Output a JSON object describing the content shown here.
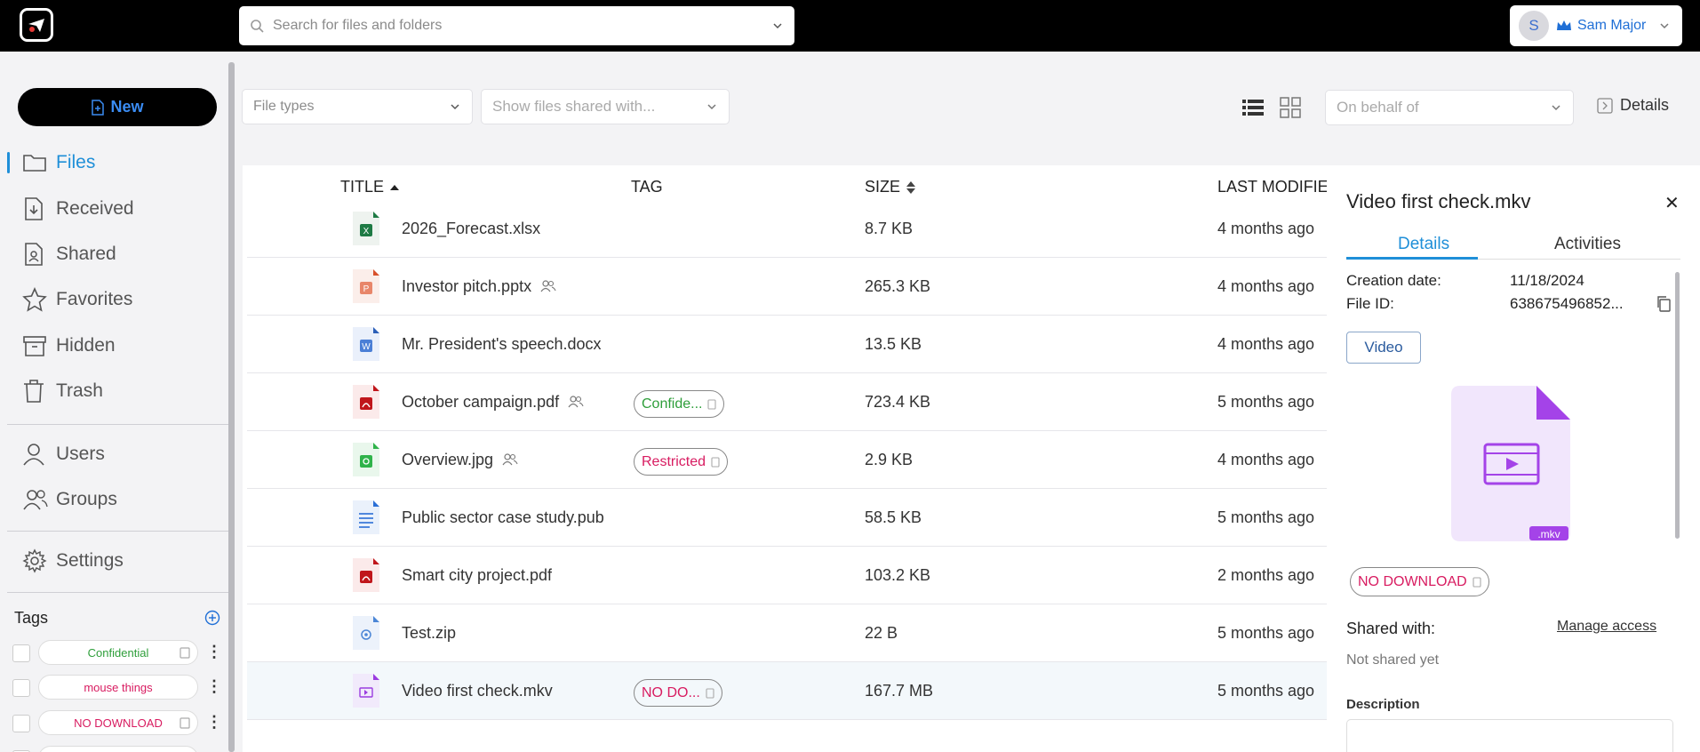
{
  "header": {
    "search_placeholder": "Search for files and folders",
    "user_initial": "S",
    "user_name": "Sam Major"
  },
  "sidebar": {
    "new_label": "New",
    "nav": [
      {
        "label": "Files",
        "icon": "folder-icon"
      },
      {
        "label": "Received",
        "icon": "received-icon"
      },
      {
        "label": "Shared",
        "icon": "shared-icon"
      },
      {
        "label": "Favorites",
        "icon": "star-icon"
      },
      {
        "label": "Hidden",
        "icon": "archive-icon"
      },
      {
        "label": "Trash",
        "icon": "trash-icon"
      },
      {
        "label": "Users",
        "icon": "user-icon"
      },
      {
        "label": "Groups",
        "icon": "groups-icon"
      },
      {
        "label": "Settings",
        "icon": "gear-icon"
      }
    ],
    "tags_title": "Tags",
    "tags": [
      {
        "label": "Confidential",
        "color": "#2e9e3a"
      },
      {
        "label": "mouse things",
        "color": "#d81b60"
      },
      {
        "label": "NO DOWNLOAD",
        "color": "#d81b60"
      }
    ]
  },
  "filters": {
    "file_types_placeholder": "File types",
    "shared_with_placeholder": "Show files shared with...",
    "on_behalf_placeholder": "On behalf of",
    "details_label": "Details"
  },
  "table": {
    "columns": {
      "title": "TITLE",
      "tag": "TAG",
      "size": "SIZE",
      "modified": "LAST MODIFIED"
    },
    "rows": [
      {
        "name": "2026_Forecast.xlsx",
        "type": "xlsx",
        "shared": false,
        "tag": "",
        "size": "8.7 KB",
        "modified": "4 months ago"
      },
      {
        "name": "Investor pitch.pptx",
        "type": "pptx",
        "shared": true,
        "tag": "",
        "size": "265.3 KB",
        "modified": "4 months ago"
      },
      {
        "name": "Mr. President's speech.docx",
        "type": "docx",
        "shared": false,
        "tag": "",
        "size": "13.5 KB",
        "modified": "4 months ago"
      },
      {
        "name": "October campaign.pdf",
        "type": "pdf",
        "shared": true,
        "tag": "Confide...",
        "tag_color": "#2e9e3a",
        "size": "723.4 KB",
        "modified": "5 months ago"
      },
      {
        "name": "Overview.jpg",
        "type": "jpg",
        "shared": true,
        "tag": "Restricted",
        "tag_color": "#d81b60",
        "size": "2.9 KB",
        "modified": "4 months ago"
      },
      {
        "name": "Public sector case study.pub",
        "type": "pub",
        "shared": false,
        "tag": "",
        "size": "58.5 KB",
        "modified": "5 months ago"
      },
      {
        "name": "Smart city project.pdf",
        "type": "pdf",
        "shared": false,
        "tag": "",
        "size": "103.2 KB",
        "modified": "2 months ago"
      },
      {
        "name": "Test.zip",
        "type": "zip",
        "shared": false,
        "tag": "",
        "size": "22 B",
        "modified": "5 months ago"
      },
      {
        "name": "Video first check.mkv",
        "type": "mkv",
        "shared": false,
        "tag": "NO DO...",
        "tag_color": "#d81b60",
        "size": "167.7 MB",
        "modified": "5 months ago"
      }
    ]
  },
  "details": {
    "title": "Video first check.mkv",
    "tabs": [
      "Details",
      "Activities"
    ],
    "creation_label": "Creation date:",
    "creation_value": "11/18/2024",
    "fileid_label": "File ID:",
    "fileid_value": "638675496852...",
    "type_button": "Video",
    "ext_badge": ".mkv",
    "tag": "NO DOWNLOAD",
    "shared_label": "Shared with:",
    "manage_label": "Manage access",
    "not_shared": "Not shared yet",
    "description_label": "Description"
  }
}
